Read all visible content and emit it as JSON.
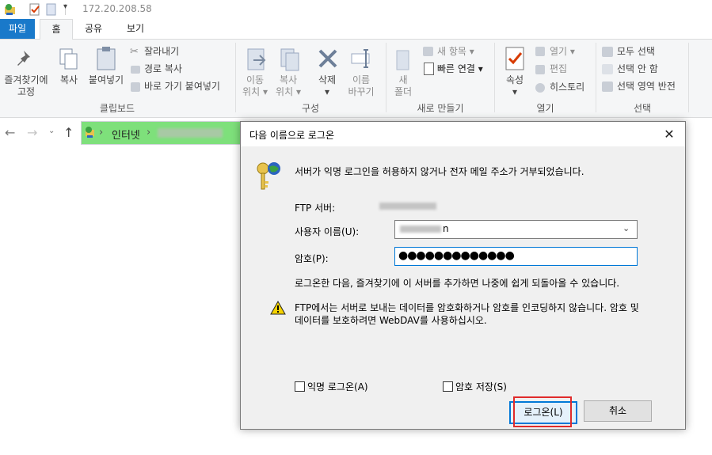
{
  "titlebar": {
    "address": "172.20.208.58"
  },
  "tabs": [
    "파일",
    "홈",
    "공유",
    "보기"
  ],
  "ribbon": {
    "clipboard": {
      "pin": [
        "즐겨찾기에",
        "고정"
      ],
      "copy": "복사",
      "paste": "붙여넣기",
      "cut": "잘라내기",
      "copy_path": "경로 복사",
      "paste_shortcut": "바로 가기 붙여넣기",
      "label": "클립보드"
    },
    "organize": {
      "move_to": [
        "이동",
        "위치"
      ],
      "copy_to": [
        "복사",
        "위치"
      ],
      "delete": "삭제",
      "rename": [
        "이름",
        "바꾸기"
      ],
      "label": "구성"
    },
    "new": {
      "new_folder": [
        "새",
        "폴더"
      ],
      "new_item": "새 항목",
      "easy_access": "빠른 연결",
      "label": "새로 만들기"
    },
    "open": {
      "properties": "속성",
      "open": "열기",
      "edit": "편집",
      "history": "히스토리",
      "label": "열기"
    },
    "select": {
      "select_all": "모두 선택",
      "select_none": "선택 안 함",
      "invert": "선택 영역 반전",
      "label": "선택"
    }
  },
  "address_bar": {
    "segment": "인터넷",
    "chevron": "›"
  },
  "dialog": {
    "title": "다음 이름으로 로그온",
    "close": "✕",
    "message": "서버가 익명 로그인을 허용하지 않거나 전자 메일 주소가 거부되었습니다.",
    "ftp_server_label": "FTP 서버:",
    "username_label": "사용자 이름(U):",
    "username_suffix": "n",
    "password_label": "암호(P):",
    "password_value": "●●●●●●●●●●●●●",
    "info": "로그온한 다음, 즐겨찾기에 이 서버를 추가하면 나중에 쉽게 되돌아올 수 있습니다.",
    "warning_line1": "FTP에서는 서버로 보내는 데이터를 암호화하거나 암호를 인코딩하지 않습니다. 암호 및",
    "warning_line2": "데이터를 보호하려면 WebDAV를 사용하십시오.",
    "anon_label": "익명 로그온(A)",
    "save_pw_label": "암호 저장(S)",
    "logon_button": "로그온(L)",
    "cancel_button": "취소"
  },
  "colors": {
    "accent": "#1979ca",
    "focus": "#0078d7",
    "highlight": "#e02b2b",
    "address_bg": "#7ee07b"
  }
}
